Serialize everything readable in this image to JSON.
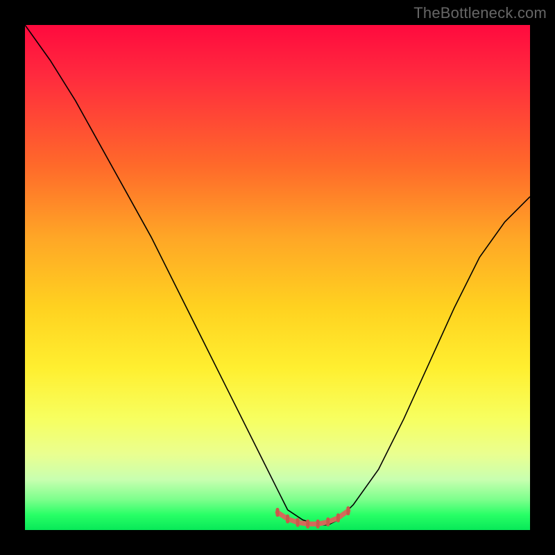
{
  "watermark": "TheBottleneck.com",
  "colors": {
    "background": "#000000",
    "gradient_top": "#ff0a3e",
    "gradient_bottom": "#08e858",
    "curve": "#000000",
    "valley_marker": "#d36a5a"
  },
  "chart_data": {
    "type": "line",
    "title": "",
    "xlabel": "",
    "ylabel": "",
    "xlim": [
      0,
      100
    ],
    "ylim": [
      0,
      100
    ],
    "grid": false,
    "legend": false,
    "annotations": [
      "TheBottleneck.com"
    ],
    "series": [
      {
        "name": "bottleneck-curve",
        "x": [
          0,
          5,
          10,
          15,
          20,
          25,
          30,
          35,
          40,
          45,
          50,
          52,
          55,
          58,
          60,
          62,
          65,
          70,
          75,
          80,
          85,
          90,
          95,
          100
        ],
        "y": [
          100,
          93,
          85,
          76,
          67,
          58,
          48,
          38,
          28,
          18,
          8,
          4,
          2,
          1,
          1,
          2,
          5,
          12,
          22,
          33,
          44,
          54,
          61,
          66
        ]
      },
      {
        "name": "valley-marker",
        "x": [
          50,
          52,
          54,
          56,
          58,
          60,
          62,
          64
        ],
        "y": [
          3.5,
          2.2,
          1.5,
          1.2,
          1.2,
          1.6,
          2.4,
          3.8
        ]
      }
    ],
    "background_gradient": {
      "direction": "top-to-bottom",
      "stops": [
        {
          "pct": 0,
          "color": "#ff0a3e"
        },
        {
          "pct": 28,
          "color": "#ff6a2a"
        },
        {
          "pct": 56,
          "color": "#ffd220"
        },
        {
          "pct": 78,
          "color": "#f7ff60"
        },
        {
          "pct": 94,
          "color": "#7cff8c"
        },
        {
          "pct": 100,
          "color": "#08e858"
        }
      ]
    }
  }
}
